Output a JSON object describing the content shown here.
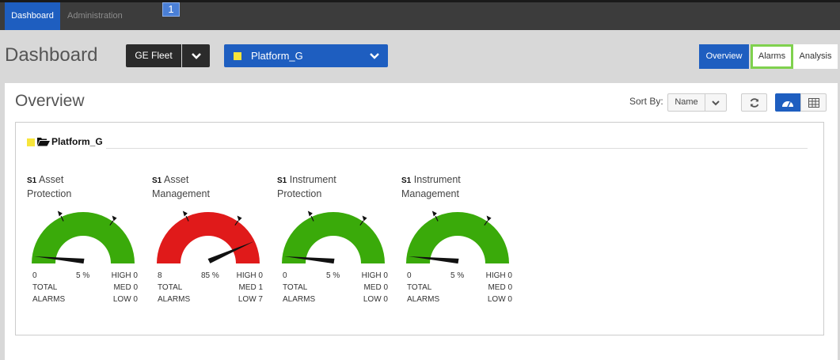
{
  "nav": {
    "tabs": [
      {
        "label": "Dashboard",
        "active": true
      },
      {
        "label": "Administration",
        "active": false
      }
    ],
    "badge": "1"
  },
  "header": {
    "title": "Dashboard",
    "fleet": "GE Fleet",
    "platform": "Platform_G",
    "views": [
      "Overview",
      "Alarms",
      "Analysis"
    ]
  },
  "panel": {
    "title": "Overview",
    "sort_label": "Sort By:",
    "sort_value": "Name"
  },
  "group": {
    "name": "Platform_G",
    "color": "#f7e53b"
  },
  "gauges": [
    {
      "code": "S1",
      "name_line1": "Asset",
      "name_line2": "Protection",
      "min": "0",
      "pct": "5 %",
      "value": 5,
      "color": "#3aaa0a",
      "high": "HIGH 0",
      "med": "MED 0",
      "low": "LOW 0"
    },
    {
      "code": "S1",
      "name_line1": "Asset",
      "name_line2": "Management",
      "min": "8",
      "pct": "85 %",
      "value": 85,
      "color": "#e01a1a",
      "high": "HIGH 0",
      "med": "MED 1",
      "low": "LOW 7"
    },
    {
      "code": "S1",
      "name_line1": "Instrument",
      "name_line2": "Protection",
      "min": "0",
      "pct": "5 %",
      "value": 5,
      "color": "#3aaa0a",
      "high": "HIGH 0",
      "med": "MED 0",
      "low": "LOW 0"
    },
    {
      "code": "S1",
      "name_line1": "Instrument",
      "name_line2": "Management",
      "min": "0",
      "pct": "5 %",
      "value": 5,
      "color": "#3aaa0a",
      "high": "HIGH 0",
      "med": "MED 0",
      "low": "LOW 0"
    }
  ],
  "total_label_1": "TOTAL",
  "total_label_2": "ALARMS",
  "colors": {
    "accent": "#1e5ec0",
    "ok": "#3aaa0a",
    "alarm": "#e01a1a",
    "highlight": "#7fd14e"
  }
}
